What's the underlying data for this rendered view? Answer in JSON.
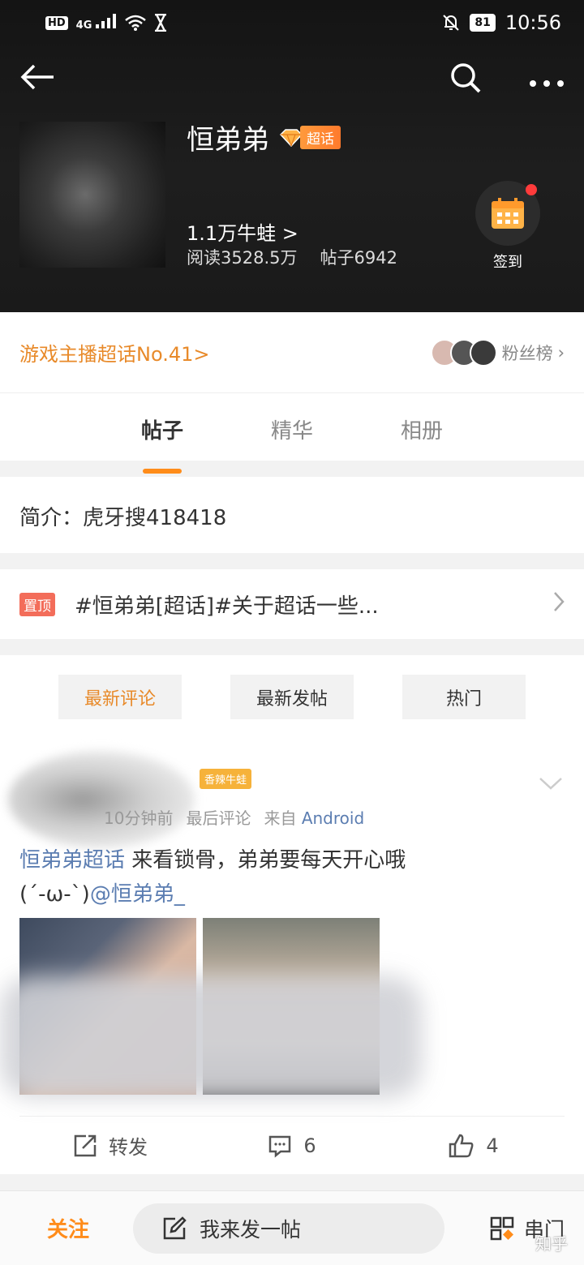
{
  "status_bar": {
    "network": "HD",
    "signal": "4G",
    "battery": "81",
    "time": "10:56"
  },
  "nav": {
    "back_icon": "back-arrow-icon",
    "search_icon": "search-icon",
    "more_icon": "more-icon"
  },
  "profile": {
    "name": "恒弟弟",
    "supertopic_tag": "超话",
    "followers": "1.1万牛蛙 >",
    "reads": "阅读3528.5万",
    "posts": "帖子6942",
    "checkin_label": "签到"
  },
  "rank": {
    "text": "游戏主播超话No.41>",
    "fan_list_label": "粉丝榜"
  },
  "tabs": [
    {
      "label": "帖子",
      "active": true
    },
    {
      "label": "精华",
      "active": false
    },
    {
      "label": "相册",
      "active": false
    }
  ],
  "intro": {
    "text": "简介：虎牙搜418418"
  },
  "pinned": {
    "tag": "置顶",
    "text": "#恒弟弟[超话]#关于超话一些..."
  },
  "filters": [
    {
      "label": "最新评论",
      "active": true
    },
    {
      "label": "最新发帖",
      "active": false
    },
    {
      "label": "热门",
      "active": false
    }
  ],
  "post": {
    "badge": "香辣牛蛙",
    "time": "10分钟前",
    "last_comment": "最后评论",
    "source_prefix": "来自",
    "source_app": "Android",
    "topic": "恒弟弟超话",
    "text_main": " 来看锁骨，弟弟要每天开心哦",
    "emoticon": "(´-ω-`)",
    "mention": "@恒弟弟_",
    "repost_label": "转发",
    "comment_count": "6",
    "like_count": "4"
  },
  "bottom_bar": {
    "follow_label": "关注",
    "compose_label": "我来发一帖",
    "chuanmen_label": "串门"
  },
  "watermark": "知乎"
}
